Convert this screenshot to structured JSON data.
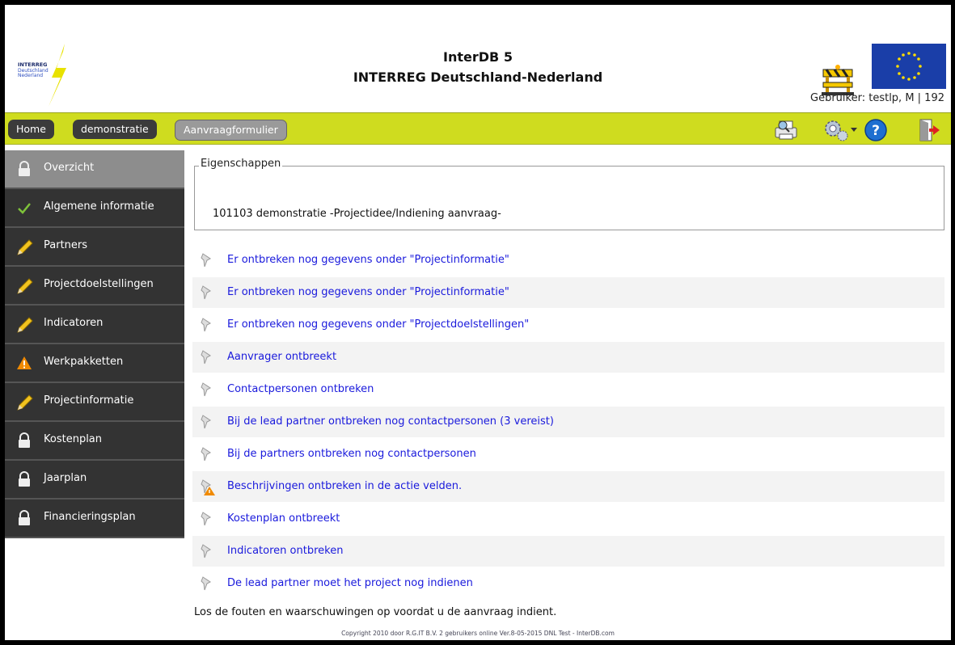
{
  "header": {
    "logo_text": "INTERREG Deutschland-Nederland",
    "title_line1": "InterDB 5",
    "title_line2": "INTERREG Deutschland-Nederland",
    "user_info": "Gebruiker: testlp, M | 192"
  },
  "nav": {
    "tabs": [
      "Home",
      "demonstratie",
      "Aanvraagformulier"
    ],
    "active_tab": "Aanvraagformulier",
    "icons": [
      "print-preview-icon",
      "settings-gear-icon",
      "help-icon",
      "logout-door-icon"
    ]
  },
  "sidebar": {
    "items": [
      {
        "label": "Overzicht",
        "icon": "lock-icon",
        "state": "active"
      },
      {
        "label": "Algemene informatie",
        "icon": "checkmark-icon",
        "state": "done"
      },
      {
        "label": "Partners",
        "icon": "pencil-icon",
        "state": "edit"
      },
      {
        "label": "Projectdoelstellingen",
        "icon": "pencil-icon",
        "state": "edit"
      },
      {
        "label": "Indicatoren",
        "icon": "pencil-icon",
        "state": "edit"
      },
      {
        "label": "Werkpakketten",
        "icon": "warning-icon",
        "state": "warning"
      },
      {
        "label": "Projectinformatie",
        "icon": "pencil-icon",
        "state": "edit"
      },
      {
        "label": "Kostenplan",
        "icon": "lock-icon",
        "state": "locked"
      },
      {
        "label": "Jaarplan",
        "icon": "lock-icon",
        "state": "locked"
      },
      {
        "label": "Financieringsplan",
        "icon": "lock-icon",
        "state": "locked"
      }
    ]
  },
  "properties": {
    "legend": "Eigenschappen",
    "text": "101103 demonstratie -Projectidee/Indiening aanvraag-"
  },
  "messages": [
    {
      "text": "Er ontbreken nog gegevens onder \"Projectinformatie\"",
      "icon": "pin-icon"
    },
    {
      "text": "Er ontbreken nog gegevens onder \"Projectinformatie\"",
      "icon": "pin-icon"
    },
    {
      "text": "Er ontbreken nog gegevens onder \"Projectdoelstellingen\"",
      "icon": "pin-icon"
    },
    {
      "text": "Aanvrager ontbreekt",
      "icon": "pin-icon"
    },
    {
      "text": "Contactpersonen ontbreken",
      "icon": "pin-icon"
    },
    {
      "text": "Bij de lead partner ontbreken nog contactpersonen (3 vereist)",
      "icon": "pin-icon"
    },
    {
      "text": "Bij de partners ontbreken nog contactpersonen",
      "icon": "pin-icon"
    },
    {
      "text": "Beschrijvingen ontbreken in de actie velden.",
      "icon": "pin-warning-icon"
    },
    {
      "text": "Kostenplan ontbreekt",
      "icon": "pin-icon"
    },
    {
      "text": "Indicatoren ontbreken",
      "icon": "pin-icon"
    },
    {
      "text": "De lead partner moet het project nog indienen",
      "icon": "pin-icon"
    }
  ],
  "footer_note": "Los de fouten en waarschuwingen op voordat u de aanvraag indient.",
  "copyright": "Copyright 2010 door R.G.IT B.V. 2 gebruikers online Ver.8-05-2015 DNL Test - InterDB.com",
  "colors": {
    "navbar": "#cfdc1f",
    "sidebar_bg": "#333333",
    "sidebar_active": "#8d8d8d",
    "link": "#1a1adc",
    "eu_blue": "#1a3ea8",
    "eu_star": "#ffdd00"
  }
}
